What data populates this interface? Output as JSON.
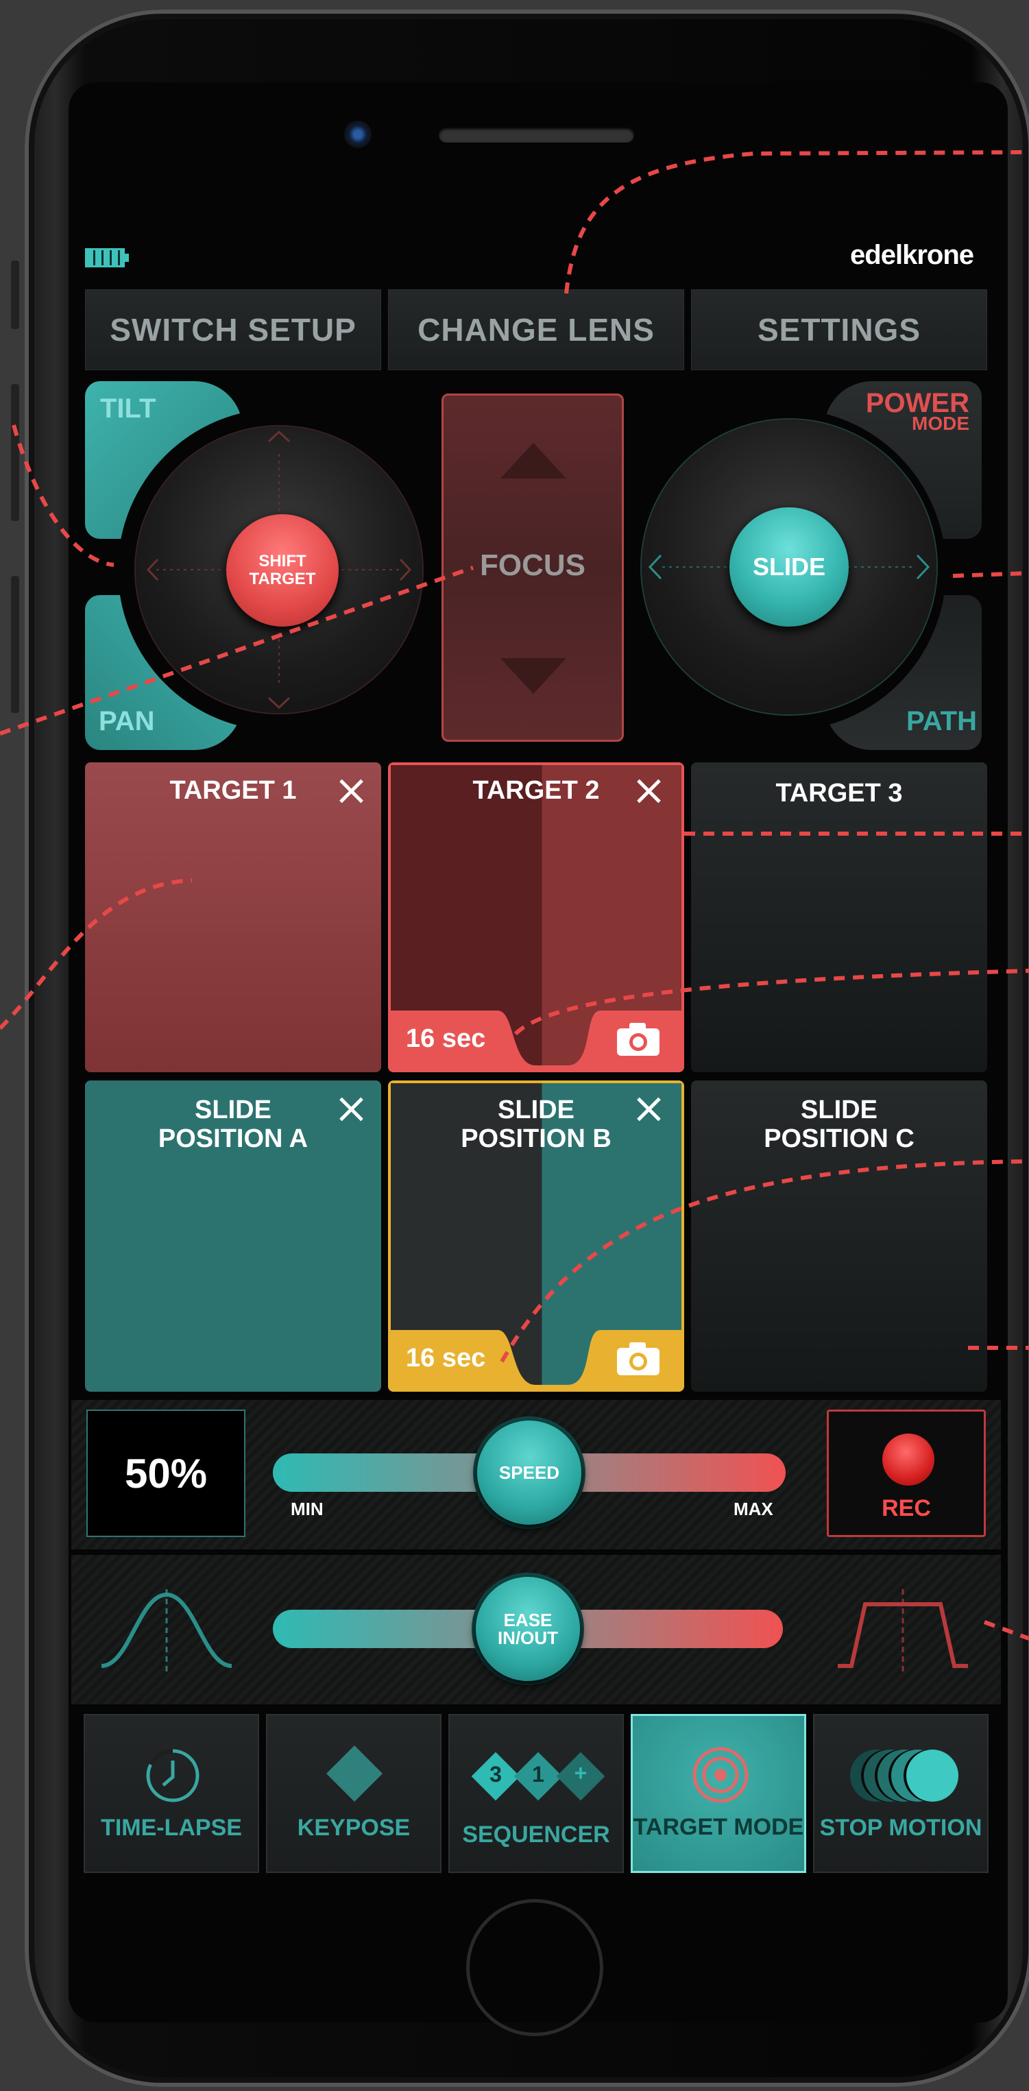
{
  "header": {
    "brand": "edelkrone"
  },
  "top_buttons": [
    "SWITCH SETUP",
    "CHANGE LENS",
    "SETTINGS"
  ],
  "left_joystick": {
    "top_tab": "TILT",
    "bottom_tab": "PAN",
    "center_label": "SHIFT\nTARGET"
  },
  "focus": {
    "label": "FOCUS"
  },
  "right_joystick": {
    "top_tab": "POWER",
    "top_tab_sub": "MODE",
    "bottom_tab": "PATH",
    "center_label": "SLIDE"
  },
  "targets": [
    {
      "title": "TARGET 1",
      "closable": true
    },
    {
      "title": "TARGET 2",
      "closable": true,
      "duration": "16 sec"
    },
    {
      "title": "TARGET 3",
      "closable": false
    }
  ],
  "slides": [
    {
      "title": "SLIDE\nPOSITION A",
      "closable": true
    },
    {
      "title": "SLIDE\nPOSITION B",
      "closable": true,
      "duration": "16 sec"
    },
    {
      "title": "SLIDE\nPOSITION C",
      "closable": false
    }
  ],
  "speed": {
    "value_text": "50%",
    "knob": "SPEED",
    "min_label": "MIN",
    "max_label": "MAX",
    "value": 0.5
  },
  "record": {
    "label": "REC"
  },
  "ease": {
    "knob": "EASE\nIN/OUT",
    "value": 0.5
  },
  "modes": [
    {
      "label": "TIME-LAPSE",
      "icon": "clock-icon",
      "active": false
    },
    {
      "label": "KEYPOSE",
      "icon": "diamond-icon",
      "active": false
    },
    {
      "label": "SEQUENCER",
      "icon": "sequencer-icon",
      "active": false,
      "steps": [
        "3",
        "1",
        "+"
      ]
    },
    {
      "label": "TARGET MODE",
      "icon": "target-icon",
      "active": true
    },
    {
      "label": "STOP MOTION",
      "icon": "stop-motion-icon",
      "active": false
    }
  ],
  "colors": {
    "teal": "#3ab3ad",
    "red": "#e95050",
    "yellow": "#e8b230",
    "accent_text": "#39a7a1"
  }
}
